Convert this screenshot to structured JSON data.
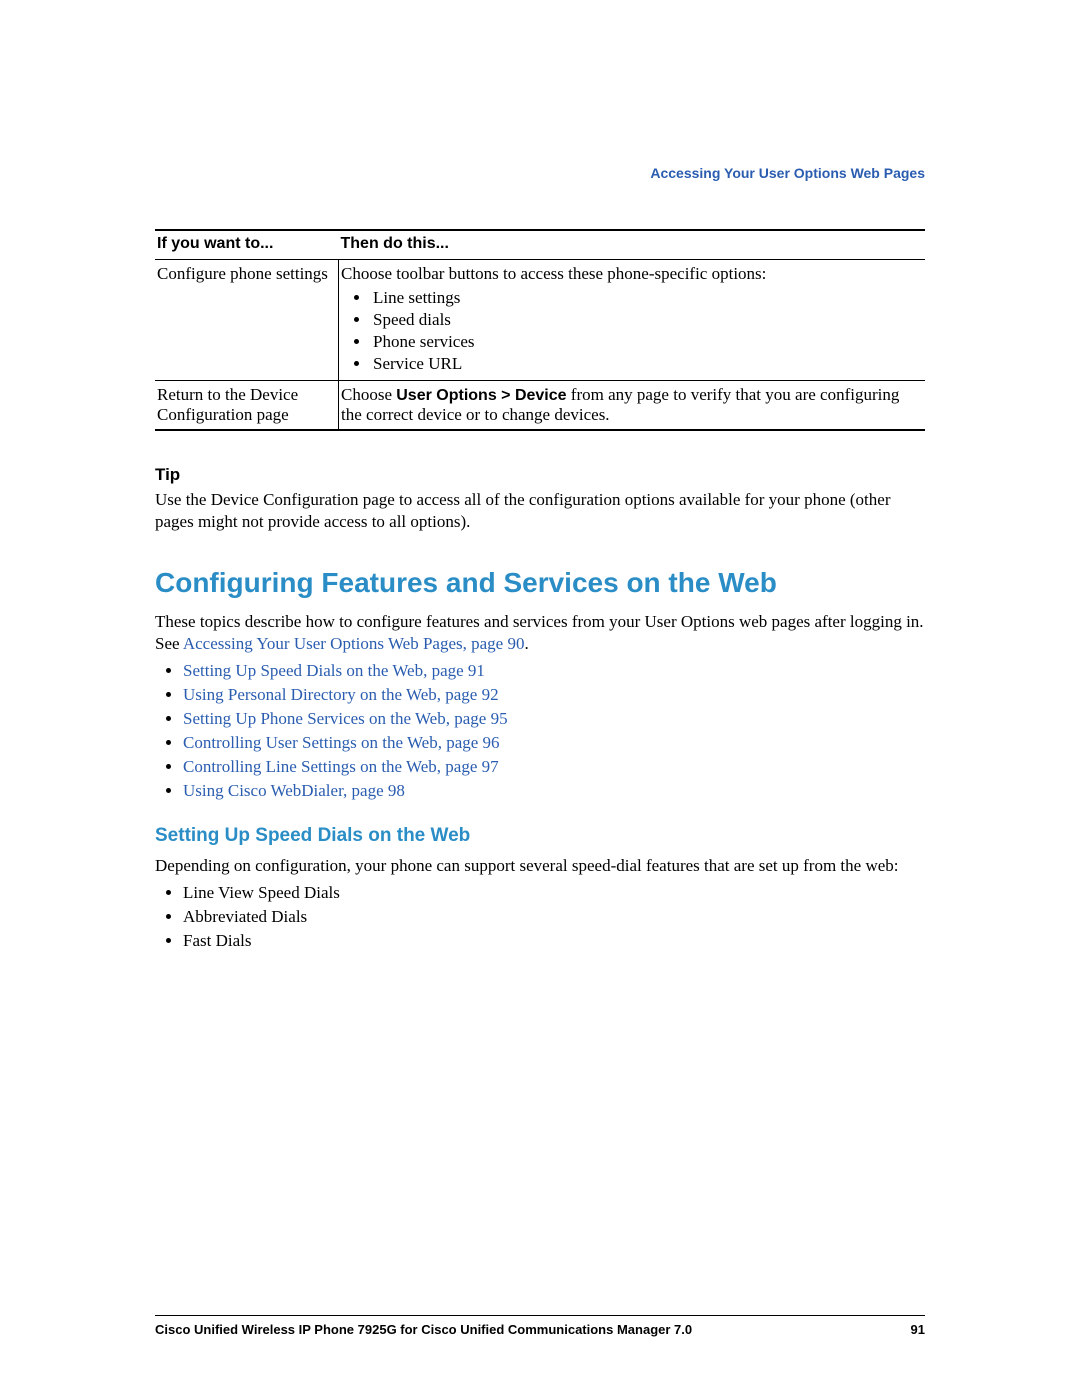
{
  "header": {
    "right": "Accessing Your User Options Web Pages"
  },
  "table": {
    "head": {
      "c1": "If you want to...",
      "c2": "Then do this..."
    },
    "row1": {
      "c1": "Configure phone settings",
      "c2_intro": "Choose toolbar buttons to access these phone-specific options:",
      "items": [
        "Line settings",
        "Speed dials",
        "Phone services",
        "Service URL"
      ]
    },
    "row2": {
      "c1": "Return to the Device Configuration page",
      "c2_pre": "Choose ",
      "c2_bold": "User Options > Device",
      "c2_post": " from any page to verify that you are configuring the correct device or to change devices."
    }
  },
  "tip": {
    "head": "Tip",
    "body": "Use the Device Configuration page to access all of the configuration options available for your phone (other pages might not provide access to all options)."
  },
  "section": {
    "title": "Configuring Features and Services on the Web",
    "intro_pre": "These topics describe how to configure features and services from your User Options web pages after logging in. See ",
    "intro_link": "Accessing Your User Options Web Pages, page 90",
    "intro_post": ".",
    "links": [
      "Setting Up Speed Dials on the Web, page 91",
      "Using Personal Directory on the Web, page 92",
      "Setting Up Phone Services on the Web, page 95",
      "Controlling User Settings on the Web, page 96",
      "Controlling Line Settings on the Web, page 97",
      "Using Cisco WebDialer, page 98"
    ]
  },
  "sub": {
    "title": "Setting Up Speed Dials on the Web",
    "intro": "Depending on configuration, your phone can support several speed-dial features that are set up from the web:",
    "items": [
      "Line View Speed Dials",
      "Abbreviated Dials",
      "Fast Dials"
    ]
  },
  "footer": {
    "title": "Cisco Unified Wireless IP Phone 7925G for Cisco Unified Communications Manager 7.0",
    "page": "91"
  }
}
